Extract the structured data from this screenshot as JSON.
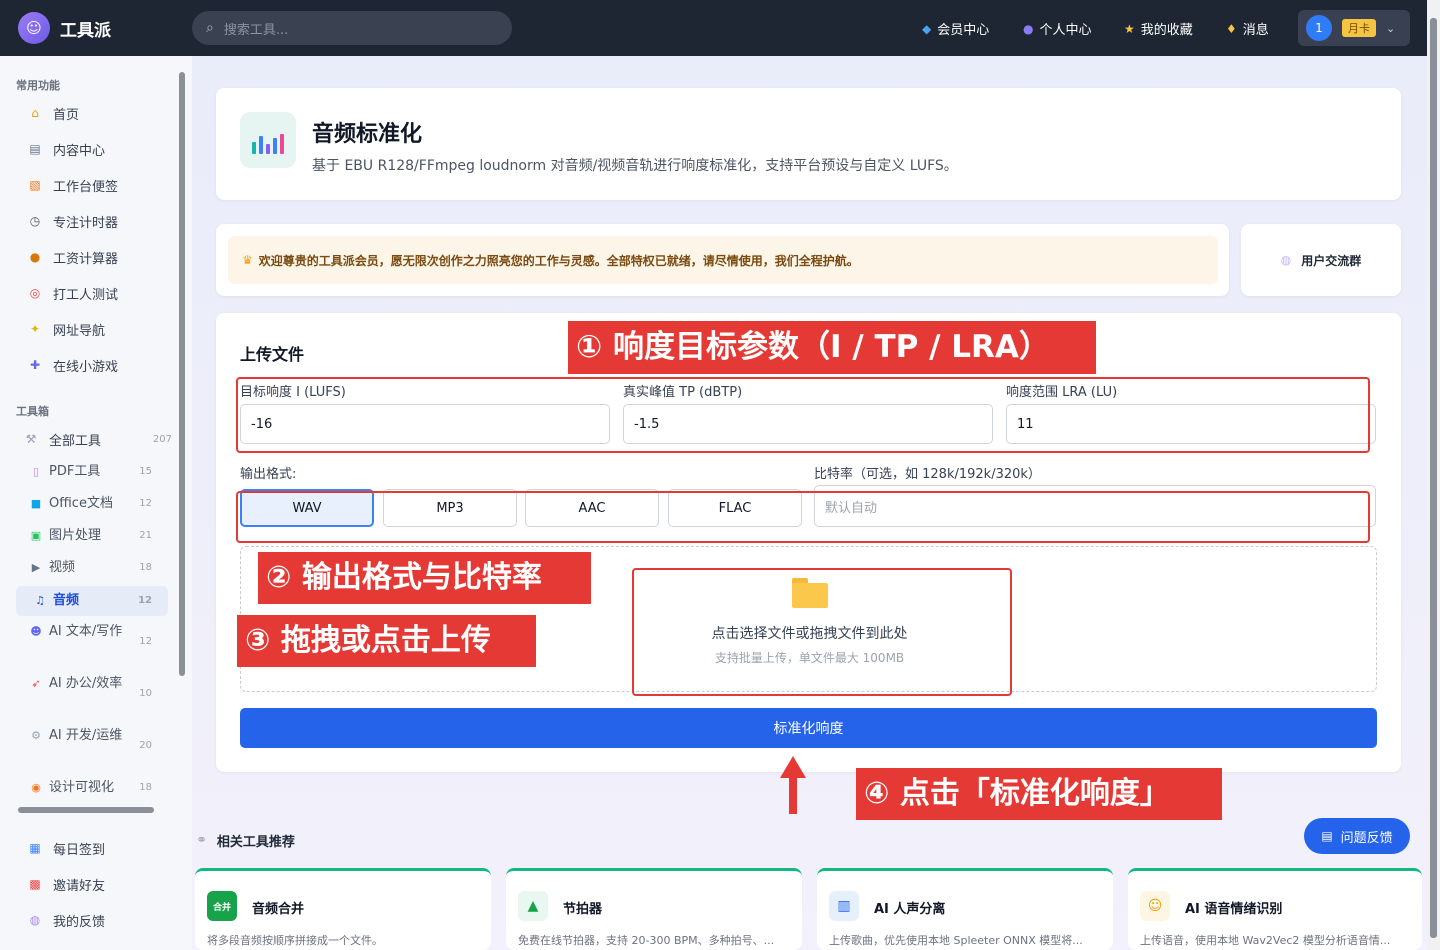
{
  "header": {
    "brand": "工具派",
    "search_placeholder": "搜索工具...",
    "nav": [
      {
        "label": "会员中心",
        "icon": "diamond-icon"
      },
      {
        "label": "个人中心",
        "icon": "user-icon"
      },
      {
        "label": "我的收藏",
        "icon": "star-icon"
      },
      {
        "label": "消息",
        "icon": "bell-icon"
      }
    ],
    "avatar_text": "1",
    "vip_badge": "月卡"
  },
  "sidebar": {
    "section_common": "常用功能",
    "common_items": [
      {
        "label": "首页",
        "icon": "home-icon"
      },
      {
        "label": "内容中心",
        "icon": "content-icon"
      },
      {
        "label": "工作台便签",
        "icon": "note-icon"
      },
      {
        "label": "专注计时器",
        "icon": "timer-icon"
      },
      {
        "label": "工资计算器",
        "icon": "money-icon"
      },
      {
        "label": "打工人测试",
        "icon": "target-icon"
      },
      {
        "label": "网址导航",
        "icon": "compass-icon"
      },
      {
        "label": "在线小游戏",
        "icon": "gamepad-icon"
      }
    ],
    "section_tools": "工具箱",
    "all_tools": {
      "label": "全部工具",
      "count": "207"
    },
    "tool_items": [
      {
        "label": "PDF工具",
        "count": "15",
        "icon": "pdf-icon"
      },
      {
        "label": "Office文档",
        "count": "12",
        "icon": "office-icon"
      },
      {
        "label": "图片处理",
        "count": "21",
        "icon": "image-icon"
      },
      {
        "label": "视频",
        "count": "18",
        "icon": "video-icon"
      },
      {
        "label": "音频",
        "count": "12",
        "icon": "music-icon"
      },
      {
        "label": "AI 文本/写作",
        "count": "12",
        "icon": "robot-icon"
      },
      {
        "label": "AI 办公/效率",
        "count": "10",
        "icon": "rocket-icon"
      },
      {
        "label": "AI 开发/运维",
        "count": "20",
        "icon": "wrench-icon"
      },
      {
        "label": "设计可视化",
        "count": "18",
        "icon": "palette-icon"
      }
    ],
    "bottom_items": [
      {
        "label": "每日签到",
        "icon": "calendar-icon"
      },
      {
        "label": "邀请好友",
        "icon": "gift-icon"
      },
      {
        "label": "我的反馈",
        "icon": "chat-icon"
      }
    ]
  },
  "page": {
    "title": "音频标准化",
    "description": "基于 EBU R128/FFmpeg loudnorm 对音频/视频音轨进行响度标准化，支持平台预设与自定义 LUFS。"
  },
  "notice": {
    "text": "欢迎尊贵的工具派会员，愿无限次创作之力照亮您的工作与灵感。全部特权已就绪，请尽情使用，我们全程护航。",
    "group_button": "用户交流群"
  },
  "upload": {
    "section_title": "上传文件",
    "target_i_label": "目标响度 I (LUFS)",
    "target_i_value": "-16",
    "tp_label": "真实峰值 TP (dBTP)",
    "tp_value": "-1.5",
    "lra_label": "响度范围 LRA (LU)",
    "lra_value": "11",
    "format_label": "输出格式:",
    "formats": [
      "WAV",
      "MP3",
      "AAC",
      "FLAC"
    ],
    "selected_format": "WAV",
    "bitrate_label": "比特率（可选，如 128k/192k/320k）",
    "bitrate_placeholder": "默认自动",
    "drop_text": "点击选择文件或拖拽文件到此处",
    "drop_hint": "支持批量上传，单文件最大 100MB",
    "submit_button": "标准化响度"
  },
  "annotations": [
    "① 响度目标参数（I / TP / LRA）",
    "② 输出格式与比特率",
    "③ 拖拽或点击上传",
    "④ 点击「标准化响度」"
  ],
  "feedback_button": "问题反馈",
  "related": {
    "title": "相关工具推荐",
    "cards": [
      {
        "name": "音频合并",
        "icon_text": "合并",
        "icon": "merge-icon",
        "desc": "将多段音频按顺序拼接成一个文件。"
      },
      {
        "name": "节拍器",
        "icon_text": "",
        "icon": "metronome-icon",
        "desc": "免费在线节拍器，支持 20-300 BPM、多种拍号、..."
      },
      {
        "name": "AI 人声分离",
        "icon_text": "",
        "icon": "vocal-split-icon",
        "desc": "上传歌曲，优先使用本地 Spleeter ONNX 模型将..."
      },
      {
        "name": "AI 语音情绪识别",
        "icon_text": "",
        "icon": "emotion-icon",
        "desc": "上传语音，使用本地 Wav2Vec2 模型分析语音情..."
      }
    ]
  },
  "colors": {
    "accent": "#2563eb",
    "topbar": "#1e2533",
    "annotation": "#e53935",
    "card_top": "#10b981"
  }
}
